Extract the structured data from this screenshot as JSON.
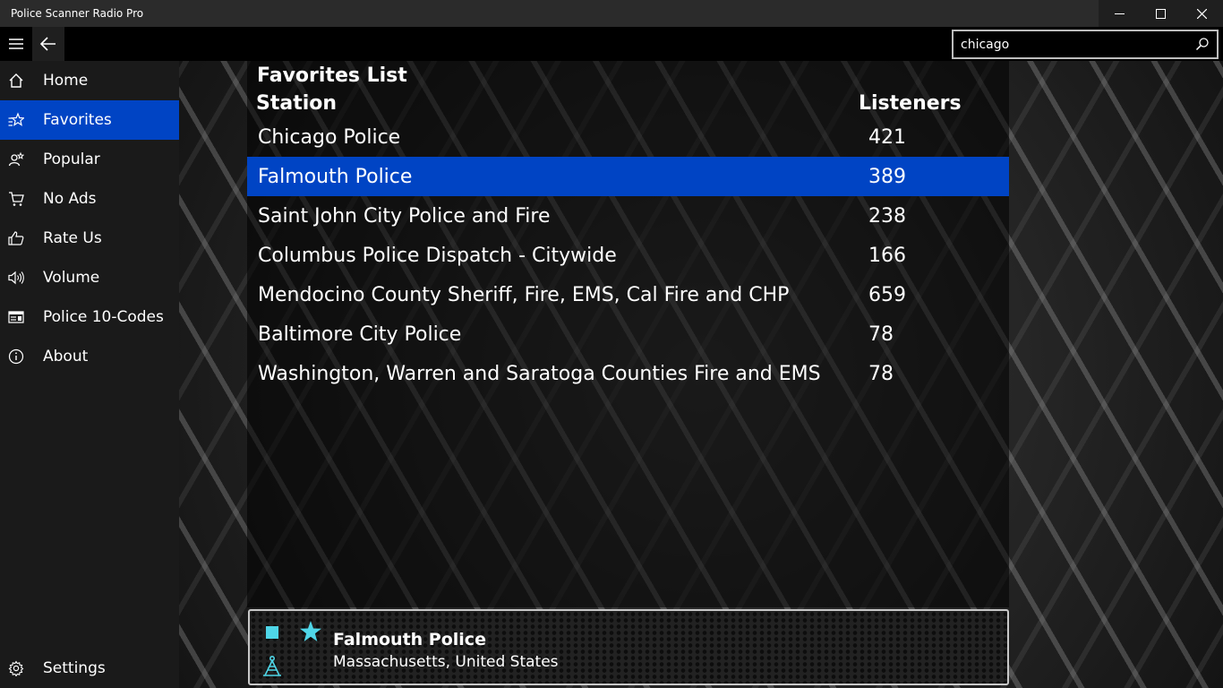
{
  "window": {
    "title": "Police Scanner Radio Pro"
  },
  "search": {
    "value": "chicago",
    "placeholder": ""
  },
  "sidebar": {
    "items": [
      {
        "label": "Home",
        "icon": "home-icon"
      },
      {
        "label": "Favorites",
        "icon": "favorites-icon",
        "active": true
      },
      {
        "label": "Popular",
        "icon": "popular-icon"
      },
      {
        "label": "No Ads",
        "icon": "cart-icon"
      },
      {
        "label": "Rate Us",
        "icon": "thumbs-up-icon"
      },
      {
        "label": "Volume",
        "icon": "volume-icon"
      },
      {
        "label": "Police 10-Codes",
        "icon": "codes-icon"
      },
      {
        "label": "About",
        "icon": "info-icon"
      }
    ],
    "settings_label": "Settings"
  },
  "main": {
    "title": "Favorites List",
    "columns": {
      "station": "Station",
      "listeners": "Listeners"
    },
    "rows": [
      {
        "station": "Chicago Police",
        "listeners": "421"
      },
      {
        "station": "Falmouth Police",
        "listeners": "389",
        "selected": true
      },
      {
        "station": "Saint John City Police and Fire",
        "listeners": "238"
      },
      {
        "station": "Columbus Police Dispatch - Citywide",
        "listeners": "166"
      },
      {
        "station": "Mendocino County Sheriff, Fire, EMS, Cal Fire and CHP",
        "listeners": "659"
      },
      {
        "station": "Baltimore City Police",
        "listeners": "78"
      },
      {
        "station": "Washington, Warren and Saratoga Counties Fire and EMS",
        "listeners": "78"
      }
    ]
  },
  "now_playing": {
    "station": "Falmouth Police",
    "location": "Massachusetts, United States"
  },
  "colors": {
    "accent": "#0044c4",
    "player_icon": "#4fd6e8"
  }
}
